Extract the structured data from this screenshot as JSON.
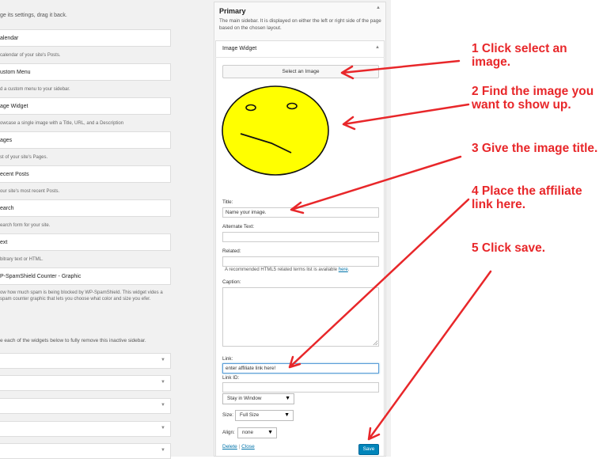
{
  "left_panel": {
    "hint": "ge its settings, drag it back.",
    "widgets": [
      {
        "title": "alendar",
        "desc": "calendar of your site's Posts."
      },
      {
        "title": "ustom Menu",
        "desc": "d a custom menu to your sidebar."
      },
      {
        "title": "age Widget",
        "desc": "owcase a single image with a Title, URL, and a Description"
      },
      {
        "title": "ages",
        "desc": "st of your site's Pages."
      },
      {
        "title": "ecent Posts",
        "desc": "our site's most recent Posts."
      },
      {
        "title": "earch",
        "desc": "earch form for your site."
      },
      {
        "title": "ext",
        "desc": "bitrary text or HTML."
      },
      {
        "title": "P-SpamShield Counter - Graphic",
        "desc": "ow how much spam is being blocked by WP-SpamShield. This widget vides a spam counter graphic that lets you choose what color and size you efer."
      }
    ],
    "inactive_text": "e each of the widgets below to fully remove this inactive sidebar.",
    "inactive_rows": 6
  },
  "sidebar": {
    "title": "Primary",
    "description": "The main sidebar. It is displayed on either the left or right side of the page based on the chosen layout.",
    "widget": {
      "title": "Image Widget",
      "select_button": "Select an Image",
      "fields": {
        "title_label": "Title:",
        "title_value": "Name your image.",
        "alt_label": "Alternate Text:",
        "related_label": "Related:",
        "related_note": "A recommended HTML5 related terms list is available",
        "related_link": "here",
        "caption_label": "Caption:",
        "link_label": "Link:",
        "link_value": "enter affiliate link here!",
        "link_id_label": "Link ID:",
        "window_select": "Stay in Window",
        "size_label": "Size:",
        "size_select": "Full Size",
        "align_label": "Align:",
        "align_select": "none"
      },
      "delete_label": "Delete",
      "separator": "|",
      "close_label": "Close",
      "save_label": "Save"
    }
  },
  "annotations": [
    "1 Click select an image.",
    "2 Find the image you want to show up.",
    "3 Give the image title.",
    "4 Place the affiliate link here.",
    "5 Click save."
  ],
  "colors": {
    "annotation": "#e8272a",
    "face": "#ffff00",
    "save_button": "#0085ba",
    "link": "#0073aa"
  }
}
